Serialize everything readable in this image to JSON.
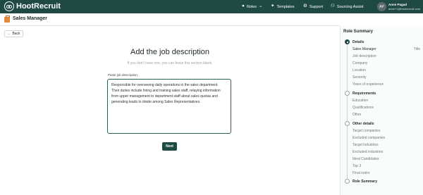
{
  "brand": {
    "name": "HootRecruit"
  },
  "nav": {
    "roles": "Roles",
    "templates": "Templates",
    "support": "Support",
    "sourcing": "Sourcing Assist"
  },
  "user": {
    "initials": "AP",
    "name": "Anne Pagad",
    "email": "anne+1@hootrecruit.com"
  },
  "subheader": {
    "title": "Sales Manager"
  },
  "back_label": "Back",
  "form": {
    "heading": "Add the job description",
    "subheading": "If you don't have one, you can leave this section blank.",
    "paste_label": "Paste job description:",
    "description": "Responsible for overseeing daily operations in the sales department. Their duties include hiring and training sales staff, relaying information from upper management to department staff about sales quotas and generating leads to divide among Sales Representatives.",
    "next_label": "Next"
  },
  "sidebar": {
    "title": "Role Summary",
    "details": {
      "label": "Details",
      "items": [
        "Sales Manager",
        "Job description",
        "Company",
        "Location",
        "Seniority",
        "Years of experience"
      ],
      "first_value": "Title"
    },
    "requirements": {
      "label": "Requirements",
      "items": [
        "Education",
        "Qualifications",
        "Other"
      ]
    },
    "other": {
      "label": "Other details",
      "items": [
        "Target companies",
        "Excluded companies",
        "Target industries",
        "Excluded industries",
        "Ideal Candidates",
        "Top 3",
        "Final notes"
      ]
    },
    "summary": {
      "label": "Role Summary"
    }
  },
  "colors": {
    "primary": "#1f4a44",
    "accent": "#e08a3c"
  },
  "icons": {
    "logo": "owl-logo-icon",
    "roles": "person-icon",
    "templates": "sparkle-icon",
    "support": "gear-icon",
    "sourcing": "people-icon",
    "case": "briefcase-icon",
    "back": "arrow-left-icon",
    "dropdown": "chevron-down-icon"
  }
}
